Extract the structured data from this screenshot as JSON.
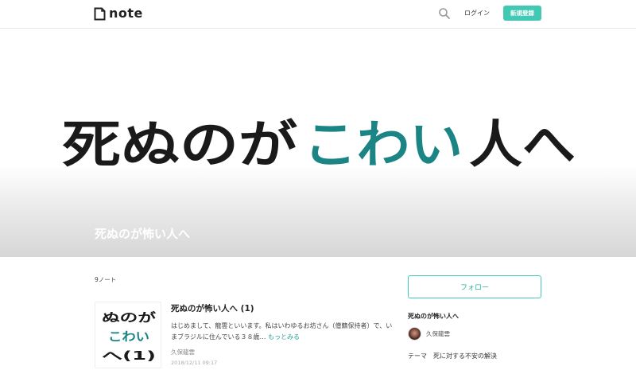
{
  "header": {
    "logo_text": "note",
    "login_label": "ログイン",
    "signup_label": "新規登録"
  },
  "hero": {
    "art_line_black_1": "死ぬのが",
    "art_line_teal": "こわい",
    "art_line_black_2": "人へ",
    "title": "死ぬのが怖い人へ"
  },
  "main": {
    "note_count": "9ノート",
    "note": {
      "thumb_line1": "ぬのが",
      "thumb_line2": "こわい",
      "thumb_line3": "へ(1)",
      "title": "死ぬのが怖い人へ (1)",
      "excerpt": "はじめまして、龍雲といいます。私はいわゆるお坊さん（僧籍保持者）で、いまブラジルに住んでいる３８歳… ",
      "more_label": "もっとみる",
      "author": "久保龍雲",
      "date": "2018/12/11 09:17"
    }
  },
  "sidebar": {
    "follow_label": "フォロー",
    "magazine_title": "死ぬのが怖い人へ",
    "owner_name": "久保龍雲",
    "description": "テーマ　死に対する不安の解決"
  },
  "colors": {
    "accent": "#41c9b4",
    "art_teal": "#1a8584",
    "art_black": "#1a1a1a"
  }
}
